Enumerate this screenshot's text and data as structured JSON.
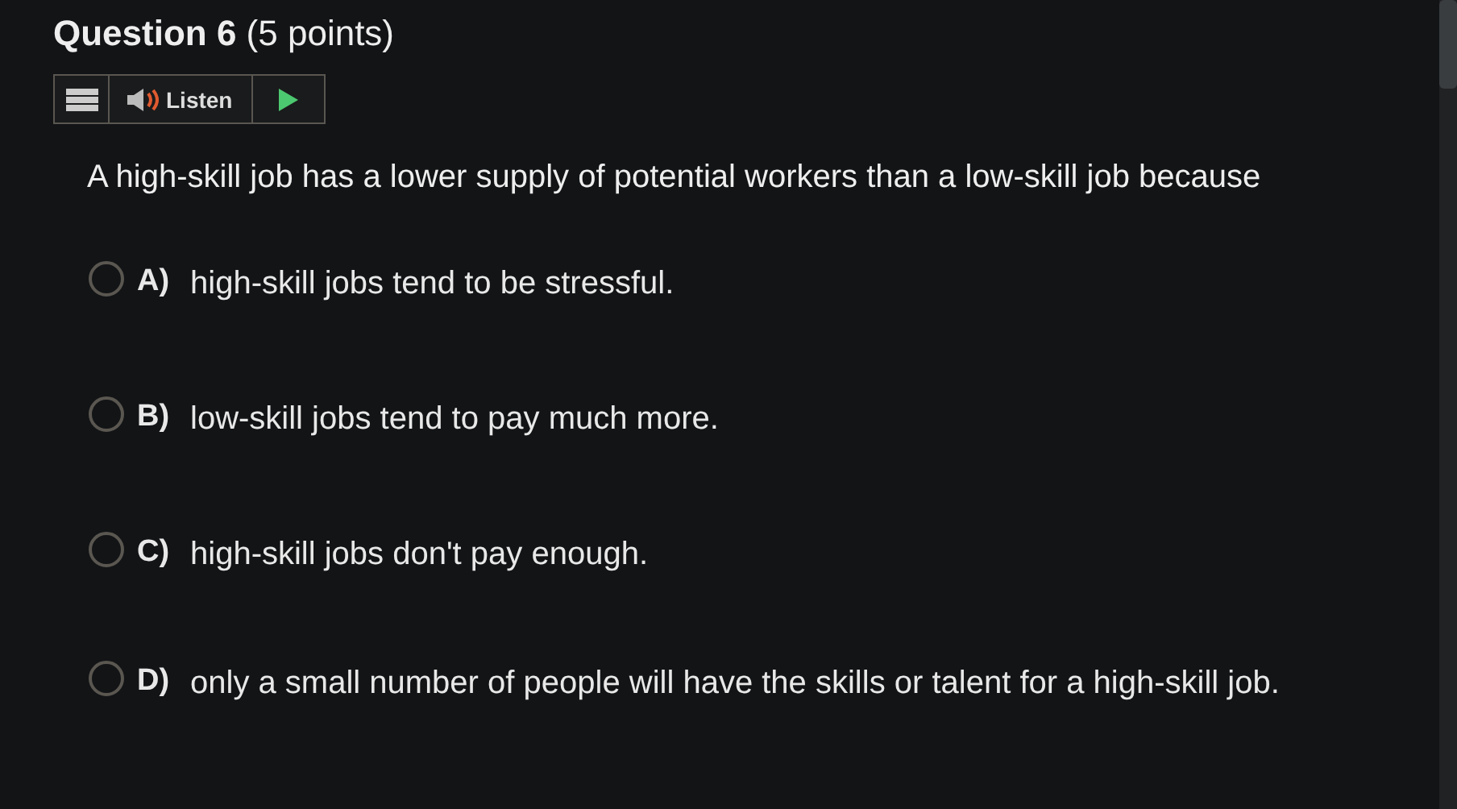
{
  "question": {
    "title": "**Question 6** (5 points)",
    "prompt": "A high-skill job has a lower supply of potential workers than a low-skill job because"
  },
  "toolbar": {
    "listen_label": "Listen"
  },
  "options": [
    {
      "letter": "A)",
      "text": "high-skill jobs tend to be stressful.",
      "selected": false
    },
    {
      "letter": "B)",
      "text": "low-skill jobs tend to pay much more.",
      "selected": false
    },
    {
      "letter": "C)",
      "text": "high-skill jobs don't pay enough.",
      "selected": false
    },
    {
      "letter": "D)",
      "text": "only a small number of people will have the skills or talent for a high-skill job.",
      "selected": false
    }
  ]
}
